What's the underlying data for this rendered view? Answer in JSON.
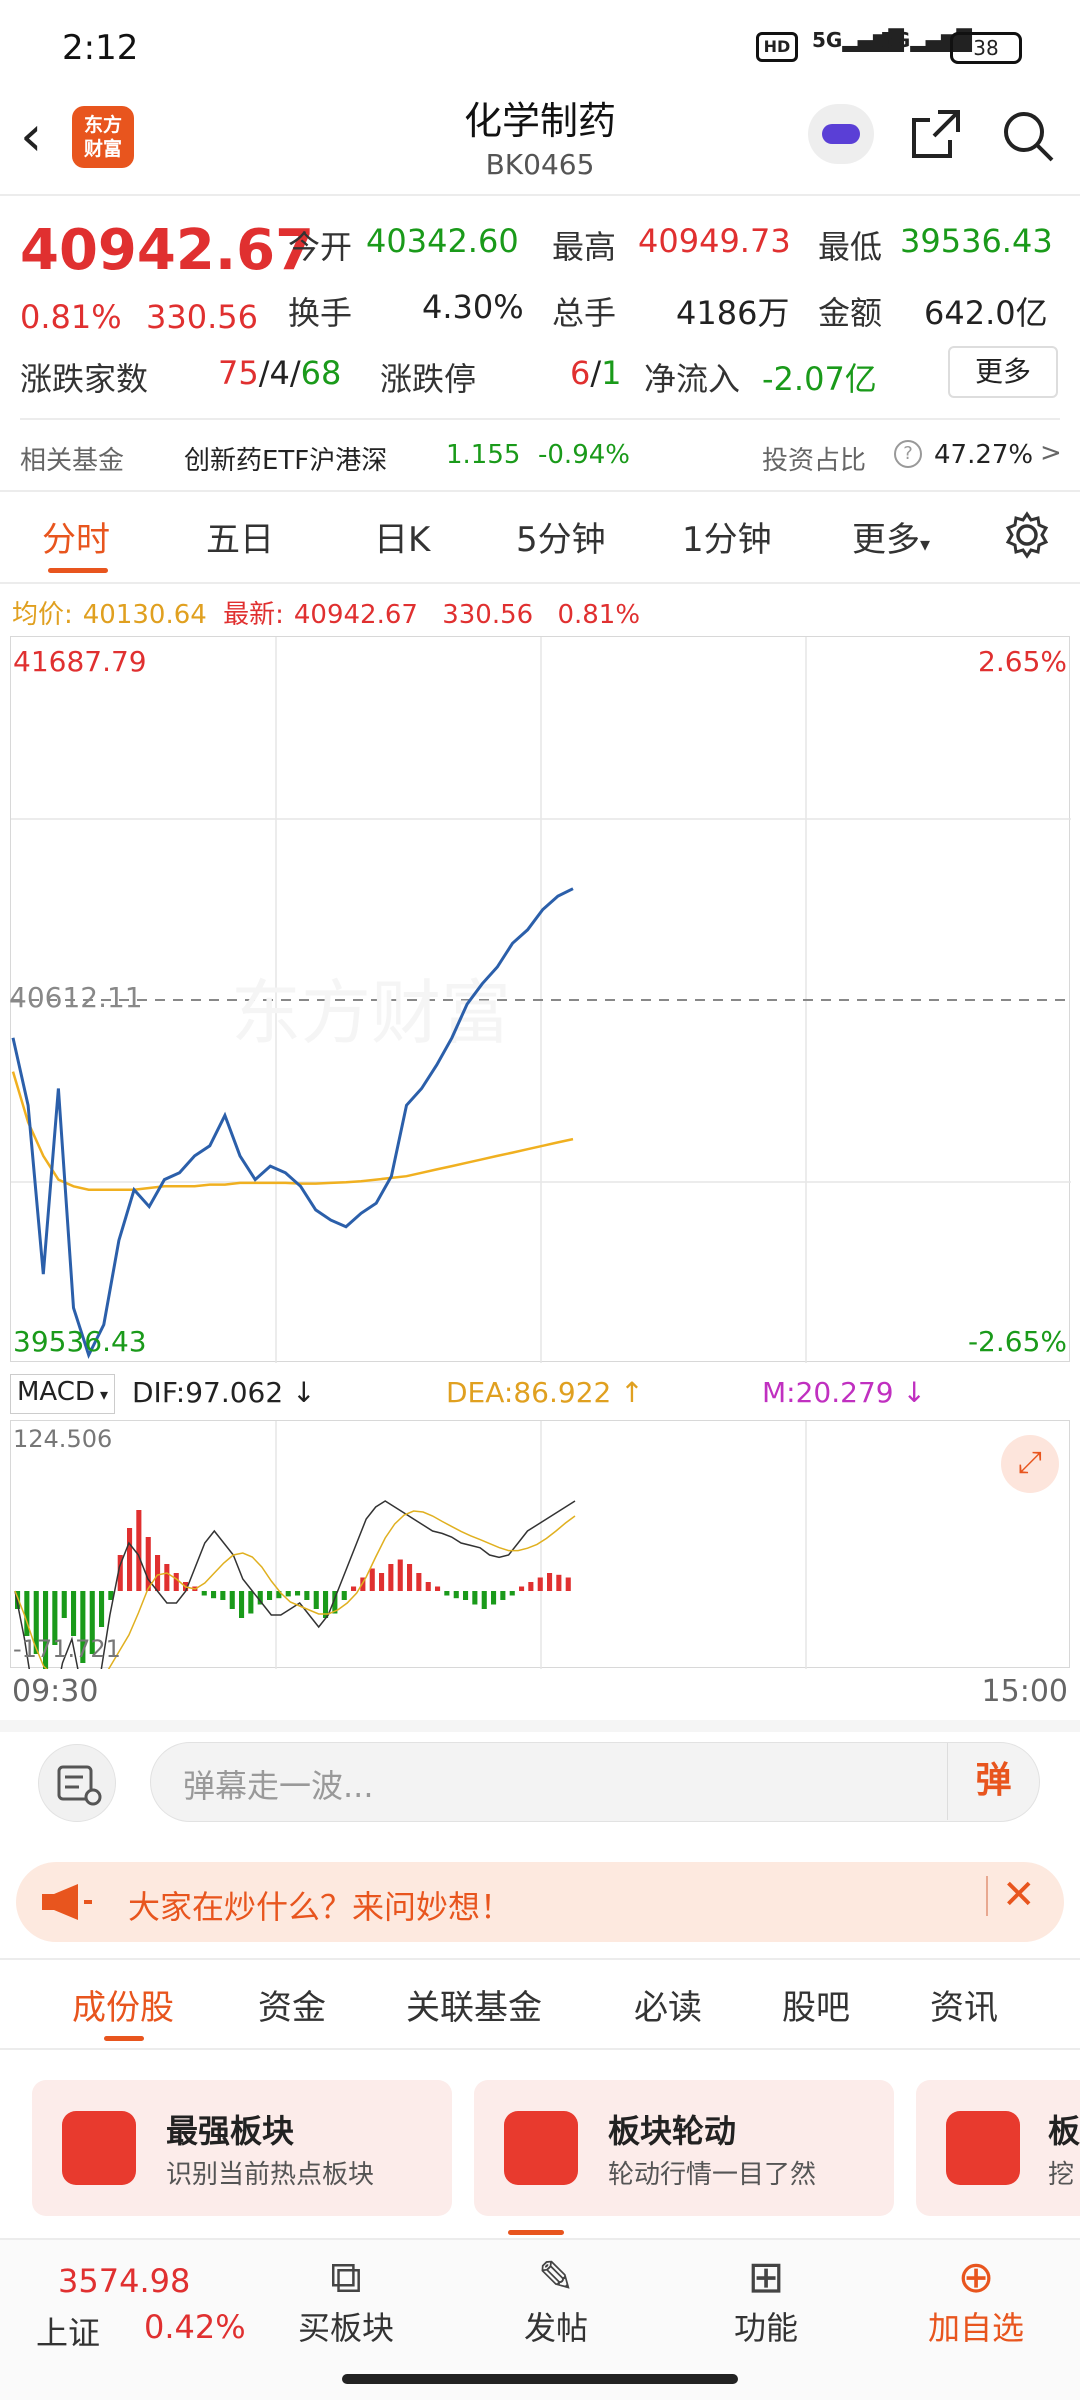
{
  "status_bar": {
    "time": "2:12",
    "network": "HD 5G 5G",
    "battery": "38"
  },
  "header": {
    "title": "化学制药",
    "code": "BK0465",
    "logo_text": "东方\n财富"
  },
  "quote": {
    "price": "40942.67",
    "change_pct": "0.81%",
    "change": "330.56",
    "open_label": "今开",
    "open": "40342.60",
    "high_label": "最高",
    "high": "40949.73",
    "low_label": "最低",
    "low": "39536.43",
    "turnover_label": "换手",
    "turnover": "4.30%",
    "volume_label": "总手",
    "volume": "4186万",
    "amount_label": "金额",
    "amount": "642.0亿",
    "updown_label": "涨跌家数",
    "up": "75",
    "flat": "4",
    "down": "68",
    "limit_label": "涨跌停",
    "limit_up": "6",
    "limit_down": "1",
    "netflow_label": "净流入",
    "netflow": "-2.07亿",
    "more": "更多"
  },
  "fund": {
    "label": "相关基金",
    "name": "创新药ETF沪港深",
    "price": "1.155",
    "change": "-0.94%",
    "ratio_label": "投资占比",
    "ratio": "47.27%"
  },
  "chart_tabs": [
    "分时",
    "五日",
    "日K",
    "5分钟",
    "1分钟",
    "更多"
  ],
  "chart_info": {
    "avg_label": "均价:",
    "avg": "40130.64",
    "last_label": "最新:",
    "last": "40942.67",
    "last_change": "330.56",
    "last_pct": "0.81%"
  },
  "chart_data": {
    "type": "line",
    "y_max_label": "41687.79",
    "y_mid_label": "40612.11",
    "y_min_label": "39536.43",
    "pct_max_label": "2.65%",
    "pct_min_label": "-2.65%",
    "x_start": "09:30",
    "x_end": "15:00",
    "ylim": [
      39536.43,
      41687.79
    ],
    "prev_close": 40612.11,
    "series": [
      {
        "values": [
          40500,
          40300,
          39800,
          40350,
          39700,
          39560,
          39650,
          39900,
          40050,
          40000,
          40080,
          40100,
          40150,
          40180,
          40270,
          40150,
          40080,
          40120,
          40100,
          40060,
          39990,
          39960,
          39940,
          39980,
          40010,
          40090,
          40300,
          40350,
          40420,
          40500,
          40600,
          40660,
          40710,
          40780,
          40820,
          40880,
          40920,
          40942
        ]
      },
      {
        "values": [
          40400,
          40250,
          40150,
          40080,
          40060,
          40050,
          40050,
          40050,
          40050,
          40055,
          40060,
          40060,
          40060,
          40065,
          40065,
          40070,
          40070,
          40070,
          40070,
          40068,
          40068,
          40070,
          40072,
          40075,
          40080,
          40085,
          40090,
          40100,
          40110,
          40120,
          40130,
          40140,
          40150,
          40160,
          40170,
          40180,
          40190,
          40200
        ]
      }
    ]
  },
  "macd": {
    "name": "MACD",
    "dif_label": "DIF:",
    "dif": "97.062",
    "dea_label": "DEA:",
    "dea": "86.922",
    "m_label": "M:",
    "m": "20.279",
    "max": "124.506",
    "min": "-171.721"
  },
  "danmu": {
    "placeholder": "弹幕走一波...",
    "button": "弹"
  },
  "banner": {
    "text": "大家在炒什么？来问妙想！"
  },
  "bottom_tabs": [
    "成份股",
    "资金",
    "关联基金",
    "必读",
    "股吧",
    "资讯"
  ],
  "cards": [
    {
      "title": "最强板块",
      "desc": "识别当前热点板块"
    },
    {
      "title": "板块轮动",
      "desc": "轮动行情一目了然"
    },
    {
      "title": "板",
      "desc": "挖"
    }
  ],
  "bottom_nav": {
    "index_price": "3574.98",
    "index_name": "上证",
    "index_pct": "0.42%",
    "items": [
      "买板块",
      "发帖",
      "功能",
      "加自选"
    ]
  }
}
